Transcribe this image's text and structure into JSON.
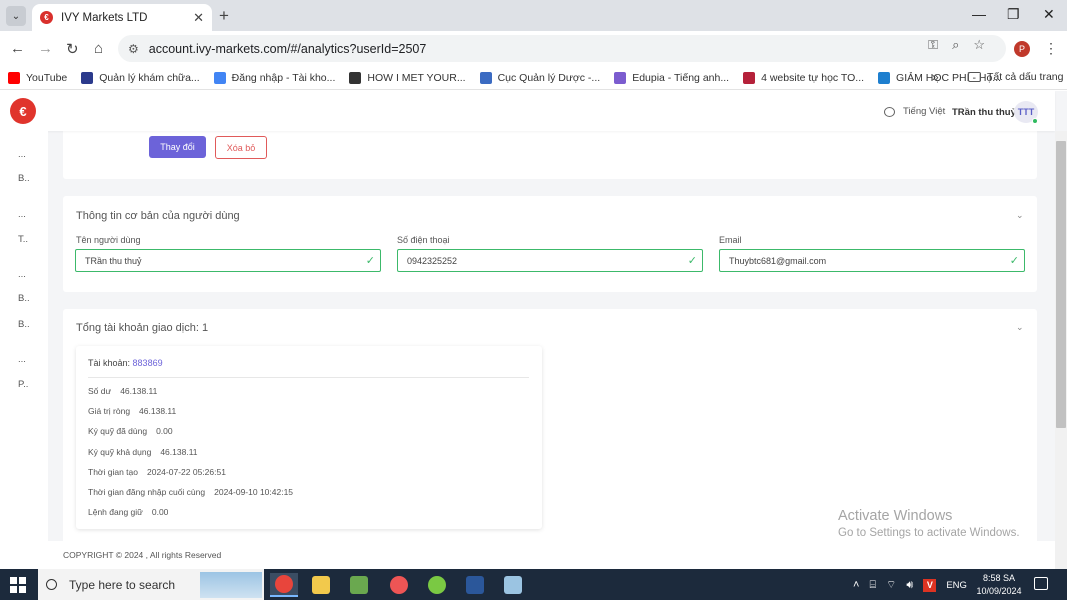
{
  "browser": {
    "tab_title": "IVY Markets LTD",
    "url": "account.ivy-markets.com/#/analytics?userId=2507",
    "profile_initial": "P",
    "bookmarks": [
      {
        "label": "YouTube",
        "color": "#ff0000"
      },
      {
        "label": "Quản lý khám chữa...",
        "color": "#2b3a8c"
      },
      {
        "label": "Đăng nhập - Tài kho...",
        "color": "#4285f4"
      },
      {
        "label": "HOW I MET YOUR...",
        "color": "#333333"
      },
      {
        "label": "Cục Quản lý Dược -...",
        "color": "#3b6bc2"
      },
      {
        "label": "Edupia - Tiếng anh...",
        "color": "#7b5ccf"
      },
      {
        "label": "4 website tự học TO...",
        "color": "#b5213a"
      },
      {
        "label": "GIẢM HỌC PHÍ - Họ...",
        "color": "#1e7fcf"
      }
    ],
    "bookmarks_more": "»",
    "all_bookmarks": "Tất cả dấu trang"
  },
  "header": {
    "language": "Tiếng Việt",
    "user_name": "TRần thu thuỷ",
    "avatar_initials": "TTT"
  },
  "sidebar": {
    "items": [
      "...",
      "B..",
      "...",
      "T..",
      "...",
      "B..",
      "B..",
      "...",
      "P.."
    ]
  },
  "avatar_card": {
    "change_label": "Thay đổi",
    "remove_label": "Xóa bỏ"
  },
  "basic_info": {
    "title": "Thông tin cơ bản của người dùng",
    "fields": [
      {
        "label": "Tên người dùng",
        "value": "TRần thu thuỷ"
      },
      {
        "label": "Số điện thoại",
        "value": "0942325252"
      },
      {
        "label": "Email",
        "value": "Thuybtc681@gmail.com"
      }
    ]
  },
  "accounts": {
    "title": "Tổng tài khoản giao dịch: 1",
    "account_label": "Tài khoản:",
    "account_number": "883869",
    "details": [
      {
        "label": "Số dư",
        "value": "46.138.11"
      },
      {
        "label": "Giá trị ròng",
        "value": "46.138.11"
      },
      {
        "label": "Ký quỹ đã dùng",
        "value": "0.00"
      },
      {
        "label": "Ký quỹ khả dụng",
        "value": "46.138.11"
      },
      {
        "label": "Thời gian tạo",
        "value": "2024-07-22 05:26:51"
      },
      {
        "label": "Thời gian đăng nhập cuối cùng",
        "value": "2024-09-10 10:42:15"
      },
      {
        "label": "Lệnh đang giữ",
        "value": "0.00"
      }
    ]
  },
  "footer": {
    "copyright": "COPYRIGHT © 2024 , All rights Reserved"
  },
  "watermark": {
    "line1": "Activate Windows",
    "line2": "Go to Settings to activate Windows."
  },
  "taskbar": {
    "search_placeholder": "Type here to search",
    "language": "ENG",
    "time": "8:58 SA",
    "date": "10/09/2024"
  }
}
